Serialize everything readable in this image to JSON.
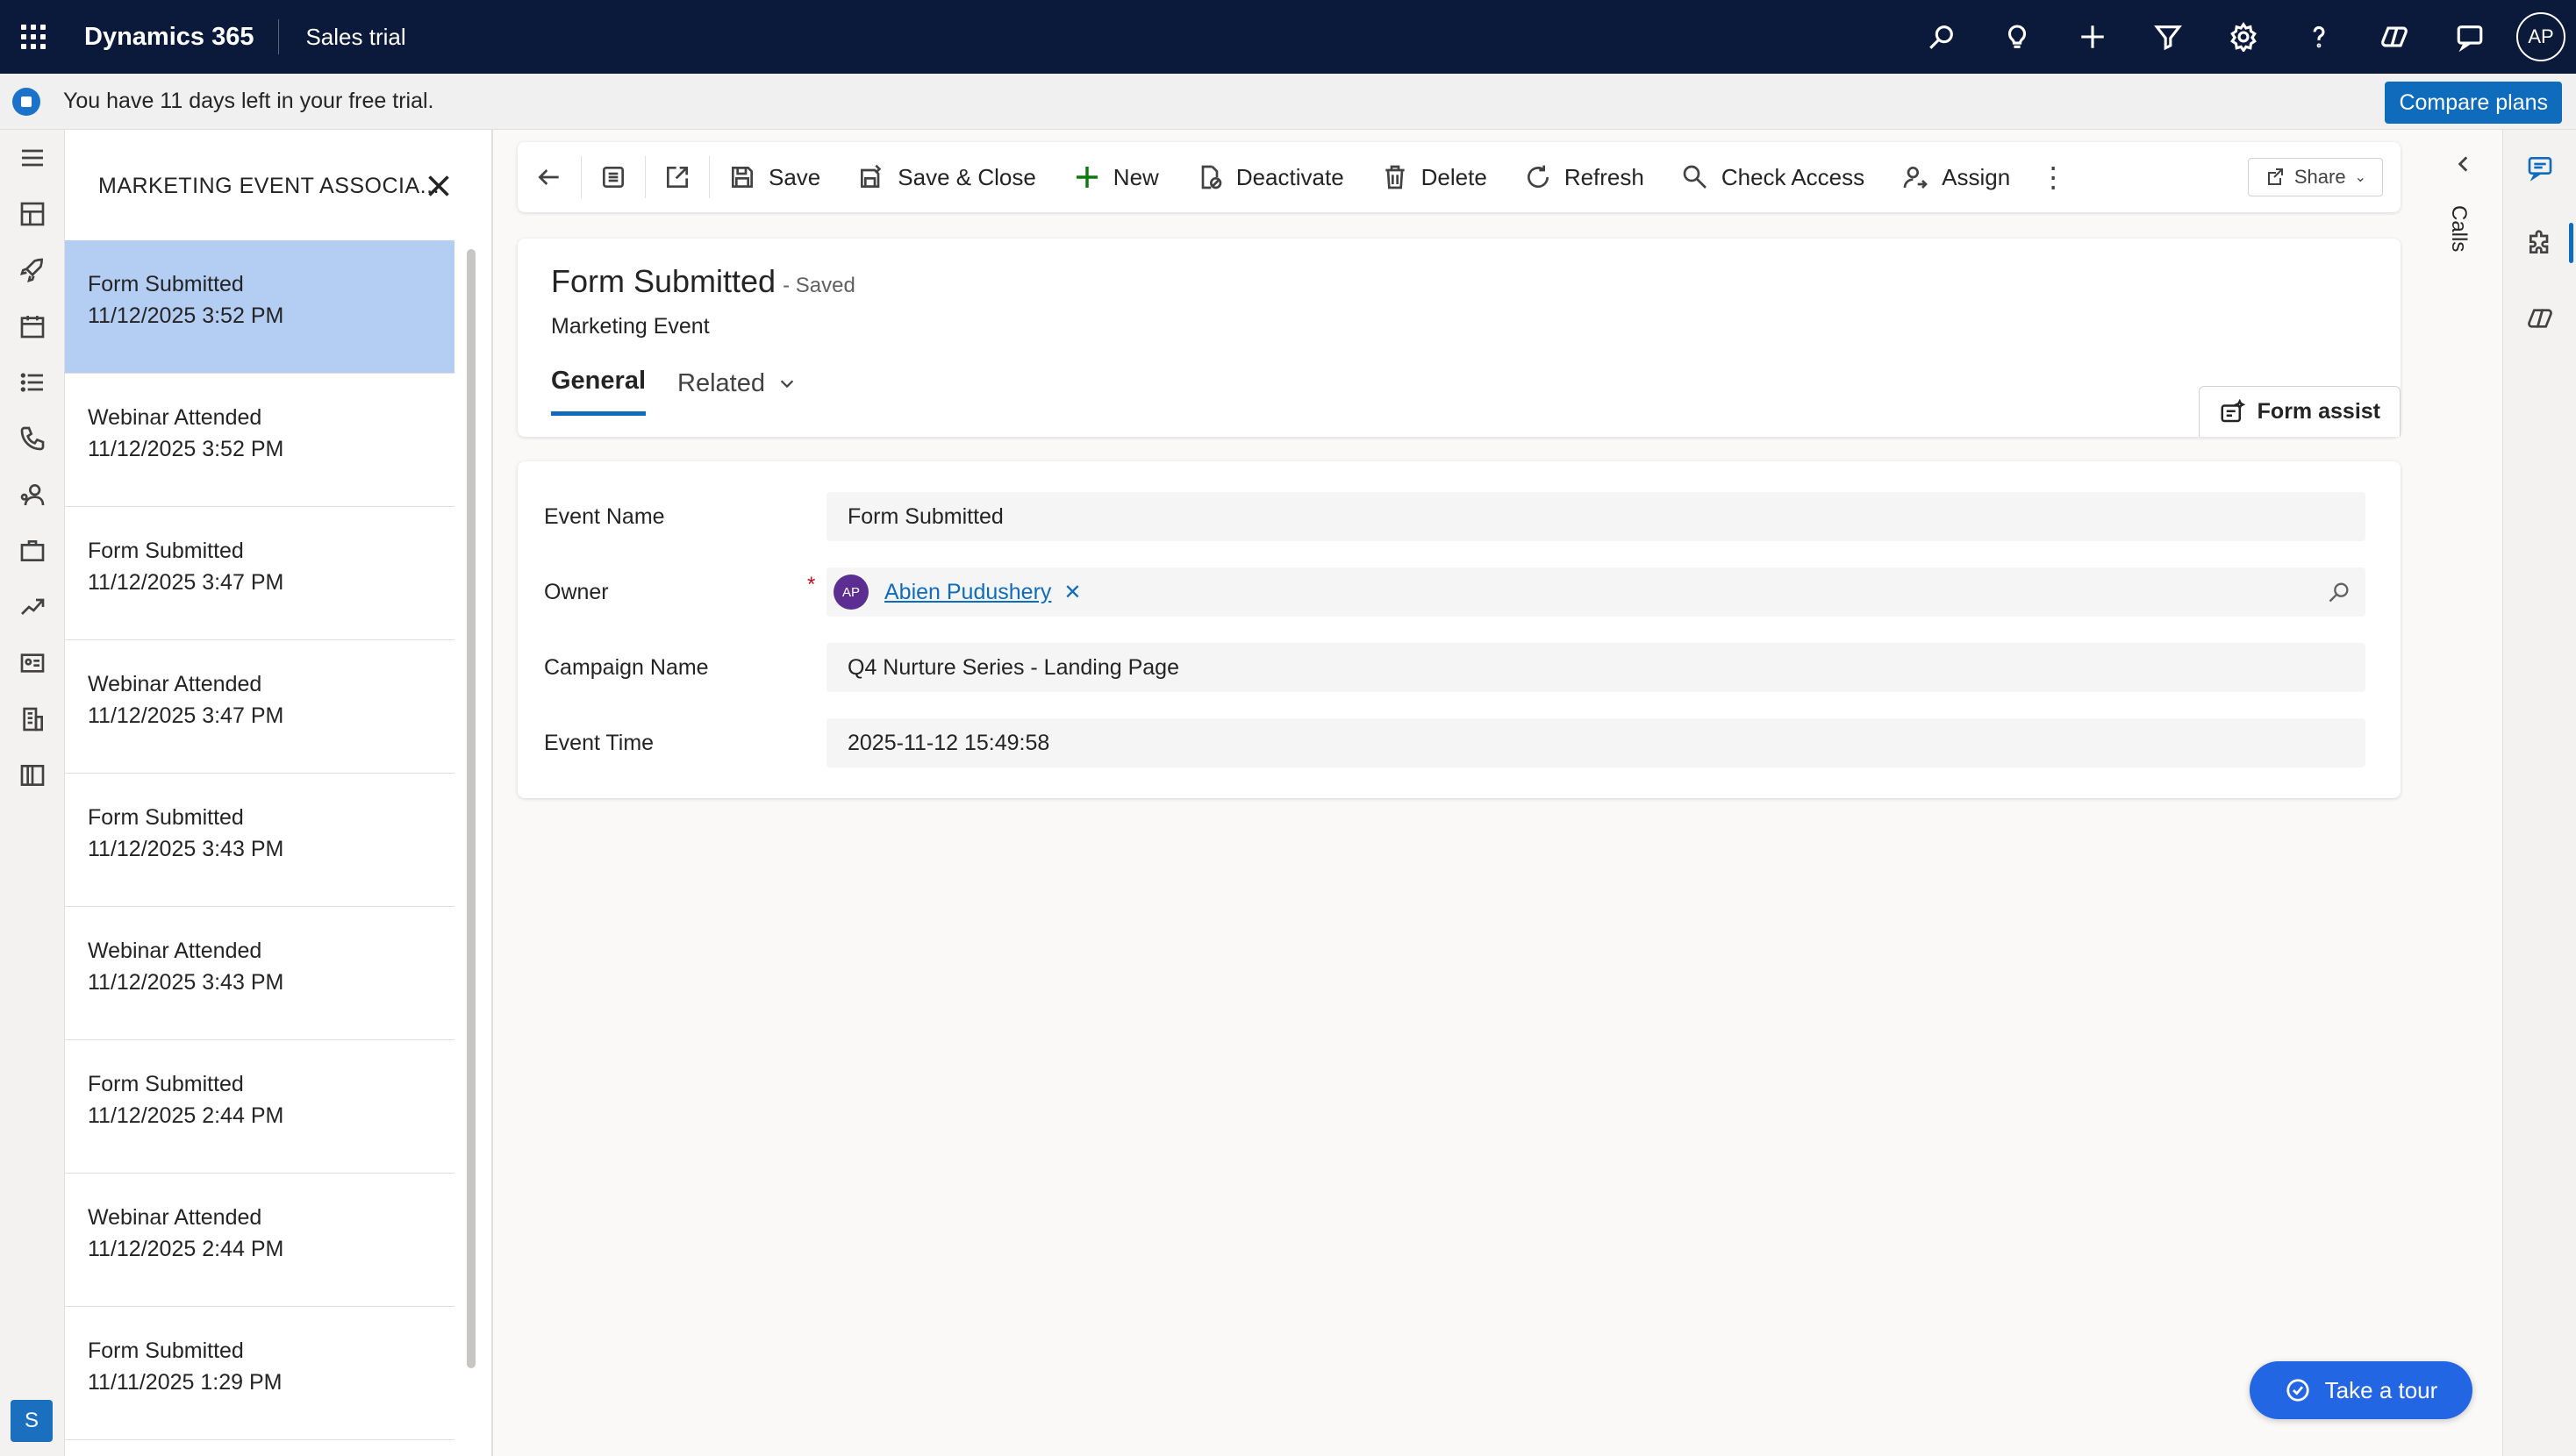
{
  "topbar": {
    "brand": "Dynamics 365",
    "app_name": "Sales trial",
    "avatar_initials": "AP",
    "icons": [
      "search-icon",
      "lightbulb-icon",
      "plus-icon",
      "filter-icon",
      "settings-icon",
      "help-icon",
      "copilot-icon",
      "feedback-icon"
    ]
  },
  "trial": {
    "message": "You have 11 days left in your free trial.",
    "compare_label": "Compare plans"
  },
  "leftnav": {
    "icons": [
      "hamburger-icon",
      "dashboard-icon",
      "rocket-icon",
      "calendar-icon",
      "list-icon",
      "phone-icon",
      "contacts-icon",
      "briefcase-icon",
      "trend-icon",
      "idcard-icon",
      "building-icon",
      "book-icon"
    ],
    "badge": "S"
  },
  "record_list": {
    "title": "MARKETING EVENT ASSOCIA...",
    "items": [
      {
        "name": "Form Submitted",
        "date": "11/12/2025 3:52 PM"
      },
      {
        "name": "Webinar Attended",
        "date": "11/12/2025 3:52 PM"
      },
      {
        "name": "Form Submitted",
        "date": "11/12/2025 3:47 PM"
      },
      {
        "name": "Webinar Attended",
        "date": "11/12/2025 3:47 PM"
      },
      {
        "name": "Form Submitted",
        "date": "11/12/2025 3:43 PM"
      },
      {
        "name": "Webinar Attended",
        "date": "11/12/2025 3:43 PM"
      },
      {
        "name": "Form Submitted",
        "date": "11/12/2025 2:44 PM"
      },
      {
        "name": "Webinar Attended",
        "date": "11/12/2025 2:44 PM"
      },
      {
        "name": "Form Submitted",
        "date": "11/11/2025 1:29 PM"
      }
    ]
  },
  "commandbar": {
    "save": "Save",
    "save_close": "Save & Close",
    "new": "New",
    "deactivate": "Deactivate",
    "delete": "Delete",
    "refresh": "Refresh",
    "check_access": "Check Access",
    "assign": "Assign",
    "share": "Share"
  },
  "record": {
    "title": "Form Submitted",
    "status": "- Saved",
    "entity": "Marketing Event",
    "tabs": {
      "general": "General",
      "related": "Related"
    },
    "form_assist": "Form assist"
  },
  "fields": {
    "event_name": {
      "label": "Event Name",
      "value": "Form Submitted"
    },
    "owner": {
      "label": "Owner",
      "required": "*",
      "initials": "AP",
      "value": "Abien Pudushery",
      "remove": "✕"
    },
    "campaign_name": {
      "label": "Campaign Name",
      "value": "Q4 Nurture Series - Landing Page"
    },
    "event_time": {
      "label": "Event Time",
      "value": "2025-11-12 15:49:58"
    }
  },
  "side_panel": {
    "calls_label": "Calls"
  },
  "tour": {
    "label": "Take a tour"
  },
  "colors": {
    "topbar": "#0b1a3a",
    "accent": "#0f6cbd",
    "selected_row": "#b4cdf3",
    "tour": "#2266e3"
  }
}
